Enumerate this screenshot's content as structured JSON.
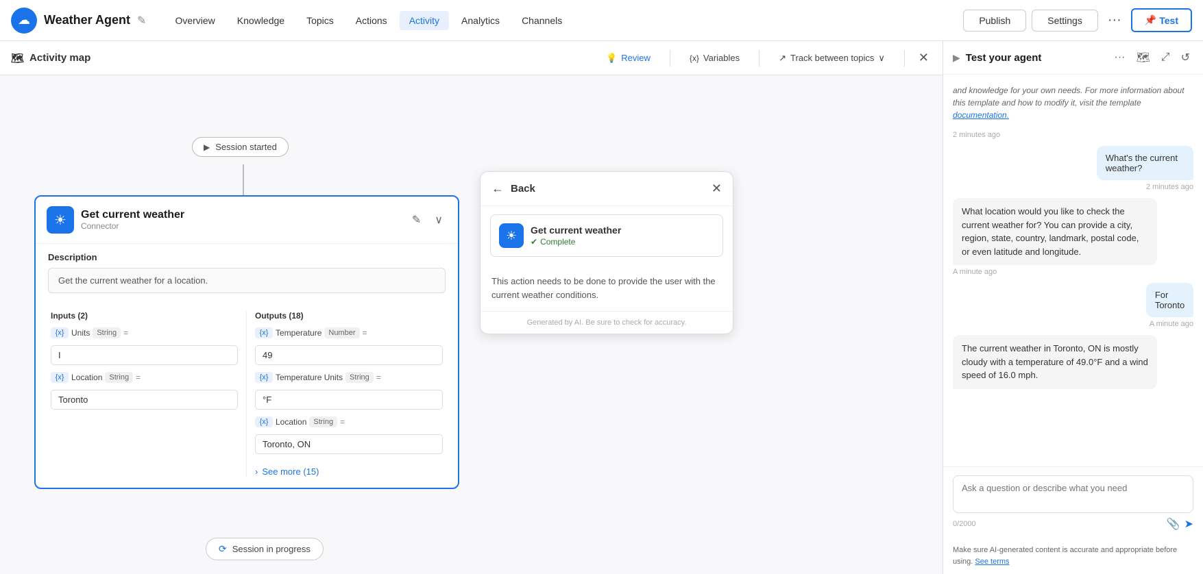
{
  "nav": {
    "logo_icon": "☁",
    "app_title": "Weather Agent",
    "edit_icon": "✎",
    "links": [
      {
        "label": "Overview",
        "active": false
      },
      {
        "label": "Knowledge",
        "active": false
      },
      {
        "label": "Topics",
        "active": false
      },
      {
        "label": "Actions",
        "active": false
      },
      {
        "label": "Activity",
        "active": true
      },
      {
        "label": "Analytics",
        "active": false
      },
      {
        "label": "Channels",
        "active": false
      }
    ],
    "publish_label": "Publish",
    "settings_label": "Settings",
    "more_icon": "···",
    "test_label": "Test",
    "pin_icon": "📌"
  },
  "canvas": {
    "toolbar": {
      "title": "Activity map",
      "map_icon": "🗺",
      "review_label": "Review",
      "review_icon": "💡",
      "variables_label": "Variables",
      "variables_icon": "{x}",
      "track_label": "Track between topics",
      "track_icon": "↗",
      "close_icon": "✕"
    },
    "session_started": "Session started",
    "play_icon": "▶",
    "card": {
      "title": "Get current weather",
      "subtitle": "Connector",
      "icon": "☀",
      "edit_icon": "✎",
      "chevron_icon": "∨",
      "description_label": "Description",
      "description_text": "Get the current weather for a location.",
      "inputs_label": "Inputs (2)",
      "outputs_label": "Outputs (18)",
      "inputs": [
        {
          "tag": "{x}",
          "name": "Units",
          "type": "String",
          "eq": "=",
          "value": "I"
        },
        {
          "tag": "{x}",
          "name": "Location",
          "type": "String",
          "eq": "=",
          "value": "Toronto"
        }
      ],
      "outputs": [
        {
          "tag": "{x}",
          "name": "Temperature",
          "type": "Number",
          "eq": "=",
          "value": "49"
        },
        {
          "tag": "{x}",
          "name": "Temperature Units",
          "type": "String",
          "eq": "=",
          "value": "°F"
        },
        {
          "tag": "{x}",
          "name": "Location",
          "type": "String",
          "eq": "=",
          "value": "Toronto, ON"
        }
      ],
      "see_more_label": "See more (15)",
      "see_more_icon": "›"
    },
    "session_progress": "Session in progress",
    "spinner_icon": "⟳"
  },
  "popup": {
    "back_icon": "←",
    "back_label": "Back",
    "close_icon": "✕",
    "card_title": "Get current weather",
    "card_icon": "☀",
    "status_label": "Complete",
    "status_icon": "✔",
    "body_text": "This action needs to be done to provide the user with the current weather conditions.",
    "footer_text": "Generated by AI. Be sure to check for accuracy."
  },
  "test_panel": {
    "expand_icon": "▶",
    "title": "Test your agent",
    "more_icon": "···",
    "map_icon": "🗺",
    "expand_window_icon": "⤢",
    "refresh_icon": "↺",
    "intro_text": "and knowledge for your own needs. For more information about this template and how to modify it, visit the template",
    "intro_link_text": "documentation.",
    "intro_link_icon": "↗",
    "messages": [
      {
        "type": "agent",
        "text": "What's the current weather?",
        "time": "2 minutes ago",
        "time_align": "right"
      },
      {
        "type": "agent",
        "text": "What location would you like to check the current weather for? You can provide a city, region, state, country, landmark, postal code, or even latitude and longitude.",
        "time": "A minute ago",
        "time_align": "left"
      },
      {
        "type": "user",
        "text": "For Toronto",
        "time": "A minute ago",
        "time_align": "right"
      },
      {
        "type": "agent",
        "text": "The current weather in Toronto, ON is mostly cloudy with a temperature of 49.0°F and a wind speed of 16.0 mph.",
        "time": "",
        "time_align": "left"
      }
    ],
    "input_placeholder": "Ask a question or describe what you need",
    "char_count": "0/2000",
    "attach_icon": "📎",
    "send_icon": "➤",
    "footer_text": "Make sure AI-generated content is accurate and appropriate before using.",
    "footer_link_text": "See terms"
  },
  "colors": {
    "brand": "#1a73e8",
    "border": "#ddd",
    "success": "#2e7d32"
  }
}
